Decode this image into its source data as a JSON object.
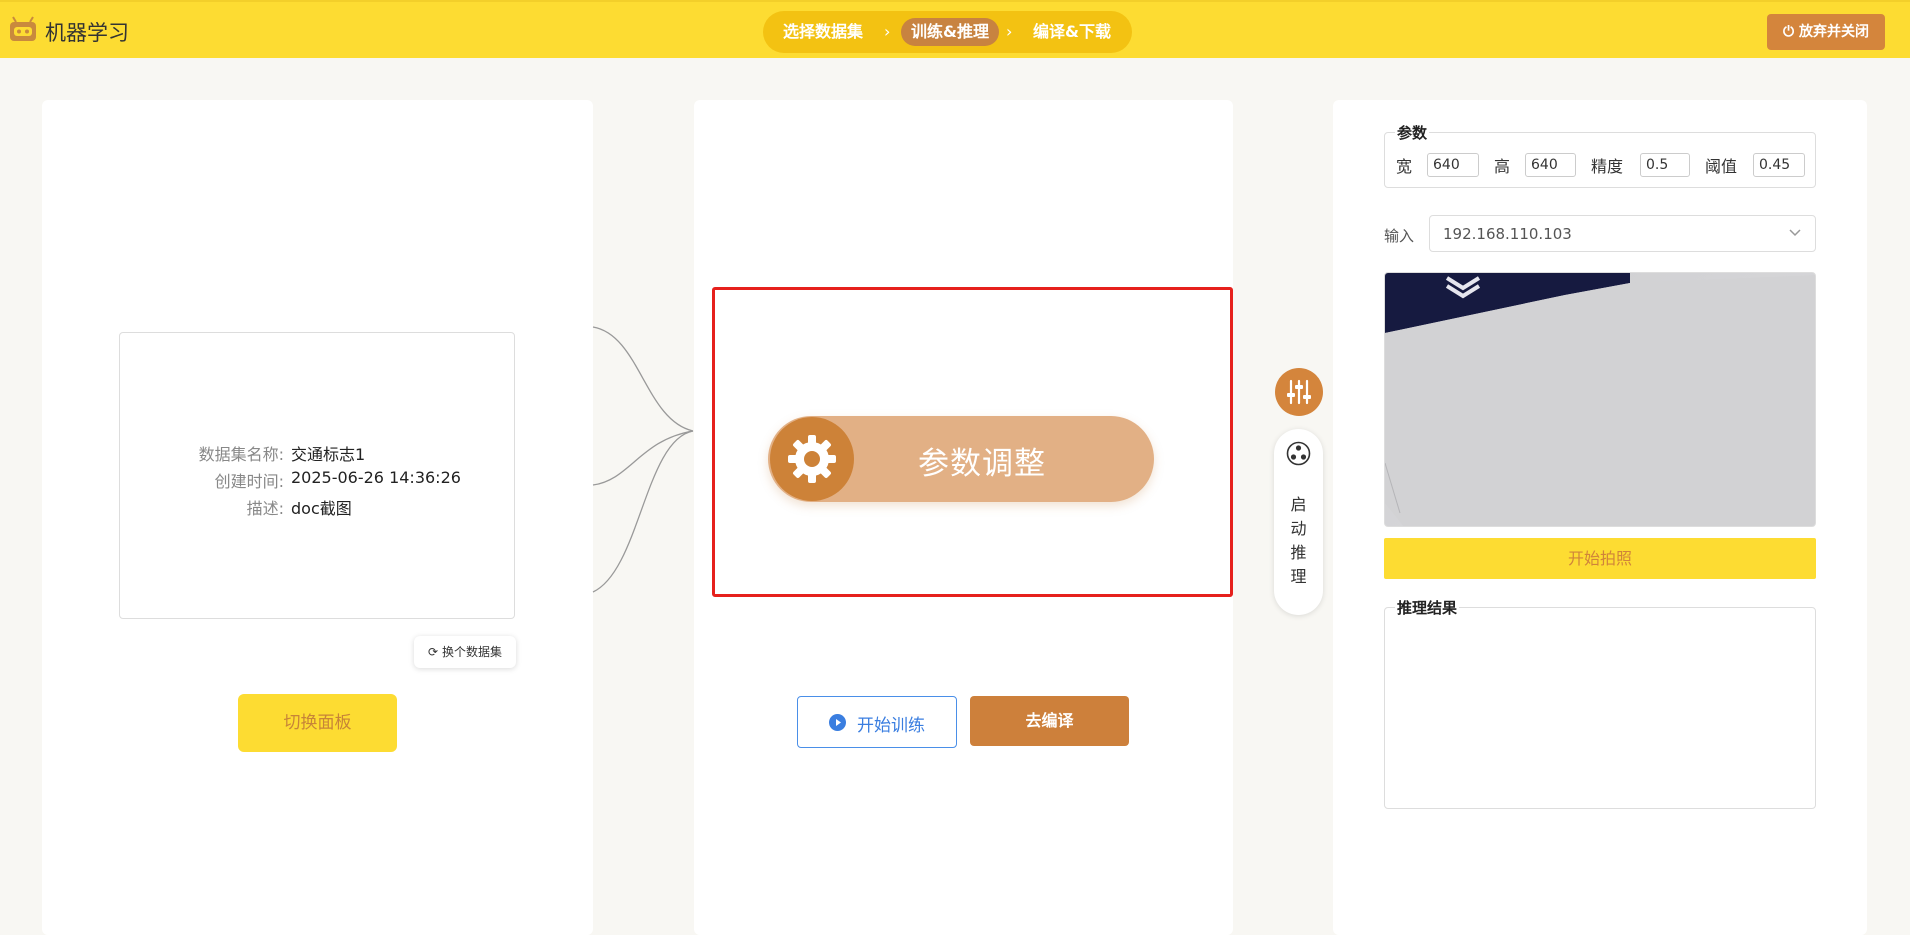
{
  "header": {
    "app_title": "机器学习",
    "logo_icon": "robot-icon",
    "steps": [
      {
        "label": "选择数据集"
      },
      {
        "label": "训练&推理"
      },
      {
        "label": "编译&下载"
      }
    ],
    "quit_label": "放弃并关闭"
  },
  "dataset": {
    "name_key": "数据集名称:",
    "name_value": "交通标志1",
    "created_key": "创建时间:",
    "created_value": "2025-06-26 14:36:26",
    "desc_key": "描述:",
    "desc_value": "doc截图",
    "swap_label": "换个数据集",
    "switch_panel_label": "切换面板"
  },
  "center": {
    "param_label": "参数调整",
    "train_label": "开始训练",
    "compile_label": "去编译"
  },
  "side": {
    "infer_label": "启动推理"
  },
  "params": {
    "legend": "参数",
    "width_label": "宽",
    "width_value": "640",
    "height_label": "高",
    "height_value": "640",
    "precision_label": "精度",
    "precision_value": "0.5",
    "threshold_label": "阈值",
    "threshold_value": "0.45"
  },
  "input": {
    "label": "输入",
    "value": "192.168.110.103"
  },
  "capture": {
    "shot_label": "开始拍照"
  },
  "result": {
    "legend": "推理结果"
  },
  "colors": {
    "topbar": "#fddc32",
    "accent": "#cd803b",
    "highlight": "#e6201c"
  }
}
